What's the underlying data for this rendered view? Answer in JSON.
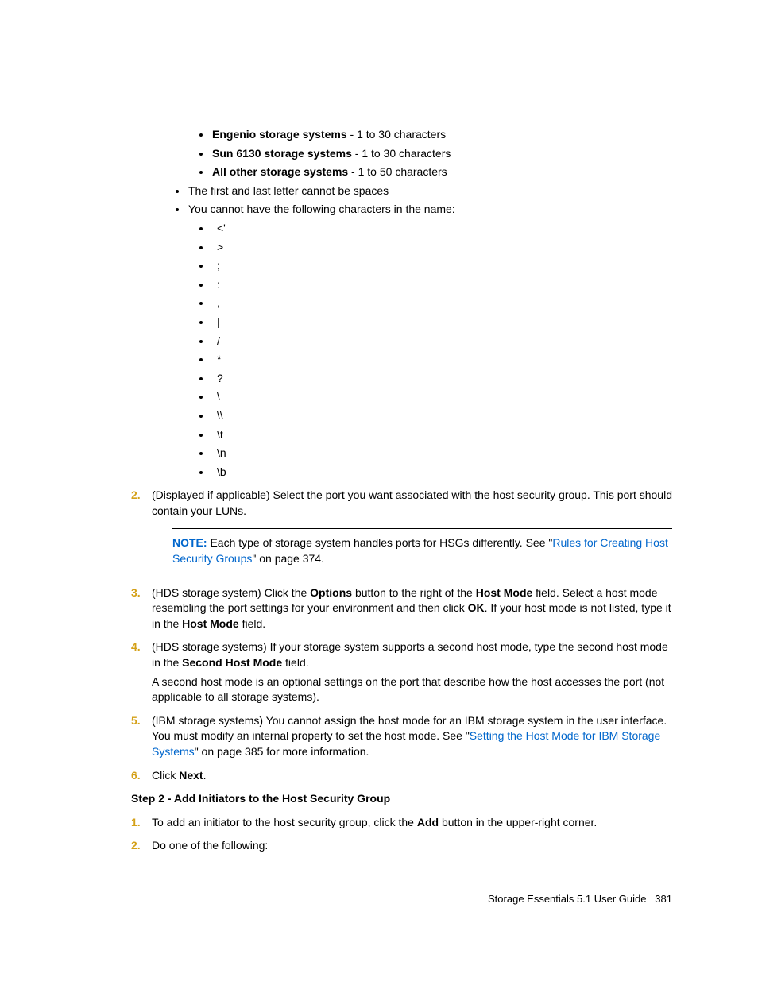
{
  "topBullets": [
    {
      "bold": "Engenio storage systems",
      "rest": " - 1 to 30 characters"
    },
    {
      "bold": "Sun 6130 storage systems",
      "rest": " - 1 to 30 characters"
    },
    {
      "bold": "All other storage systems",
      "rest": " - 1 to 50 characters"
    }
  ],
  "ruleBullets": [
    "The first and last letter cannot be spaces",
    "You cannot have the following characters in the name:"
  ],
  "charList": [
    "<'",
    ">",
    ";",
    ":",
    ",",
    "|",
    "/",
    "*",
    "?",
    "\\",
    "\\\\",
    "\\t",
    "\\n",
    "\\b"
  ],
  "steps": {
    "s2": "(Displayed if applicable) Select the port you want associated with the host security group. This port should contain your LUNs.",
    "noteLabel": "NOTE:",
    "noteText1": "   Each type of storage system handles ports for HSGs differently. See \"",
    "noteLink1": "Rules for Creating Host Security Groups",
    "noteText2": "\" on page 374.",
    "s3a": "(HDS storage system) Click the ",
    "s3b": "Options",
    "s3c": " button to the right of the ",
    "s3d": "Host Mode",
    "s3e": " field. Select a host mode resembling the port settings for your environment and then click ",
    "s3f": "OK",
    "s3g": ". If your host mode is not listed, type it in the ",
    "s3h": "Host Mode",
    "s3i": " field.",
    "s4a": "(HDS storage systems) If your storage system supports a second host mode, type the second host mode in the ",
    "s4b": "Second Host Mode",
    "s4c": " field.",
    "s4para": "A second host mode is an optional settings on the port that describe how the host accesses the port (not applicable to all storage systems).",
    "s5a": "(IBM storage systems) You cannot assign the host mode for an IBM storage system in the user interface. You must modify an internal property to set the host mode. See \"",
    "s5link": "Setting the Host Mode for IBM Storage Systems",
    "s5b": "\" on page 385 for more information.",
    "s6a": "Click ",
    "s6b": "Next",
    "s6c": "."
  },
  "step2Heading": "Step 2 - Add Initiators to the Host Security Group",
  "step2items": {
    "i1a": "To add an initiator to the host security group, click the ",
    "i1b": "Add",
    "i1c": " button in the upper-right corner.",
    "i2": "Do one of the following:"
  },
  "footer": {
    "title": "Storage Essentials 5.1 User Guide",
    "page": "381"
  }
}
